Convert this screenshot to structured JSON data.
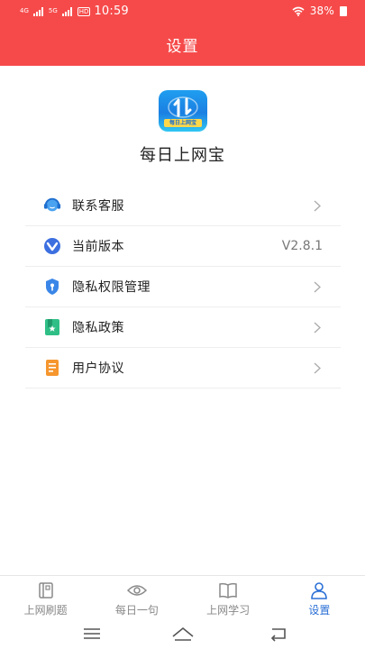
{
  "status_bar": {
    "network_1": "4G",
    "network_2": "5G",
    "hd": "HD",
    "time": "10:59",
    "battery": "38%"
  },
  "header": {
    "title": "设置"
  },
  "app": {
    "name": "每日上网宝",
    "logo_banner": "每日上网宝"
  },
  "menu": [
    {
      "label": "联系客服",
      "icon": "customer-service-icon",
      "value": ""
    },
    {
      "label": "当前版本",
      "icon": "version-icon",
      "value": "V2.8.1"
    },
    {
      "label": "隐私权限管理",
      "icon": "privacy-shield-icon",
      "value": ""
    },
    {
      "label": "隐私政策",
      "icon": "privacy-policy-icon",
      "value": ""
    },
    {
      "label": "用户协议",
      "icon": "user-agreement-icon",
      "value": ""
    }
  ],
  "tabs": [
    {
      "label": "上网刷题",
      "icon": "quiz-book-icon",
      "active": false
    },
    {
      "label": "每日一句",
      "icon": "eye-icon",
      "active": false
    },
    {
      "label": "上网学习",
      "icon": "open-book-icon",
      "active": false
    },
    {
      "label": "设置",
      "icon": "user-icon",
      "active": true
    }
  ],
  "colors": {
    "header_bg": "#f64a4a",
    "active_tab": "#2a6fd6",
    "logo_blue": "#1b7fe2",
    "logo_banner": "#ffd84a"
  }
}
